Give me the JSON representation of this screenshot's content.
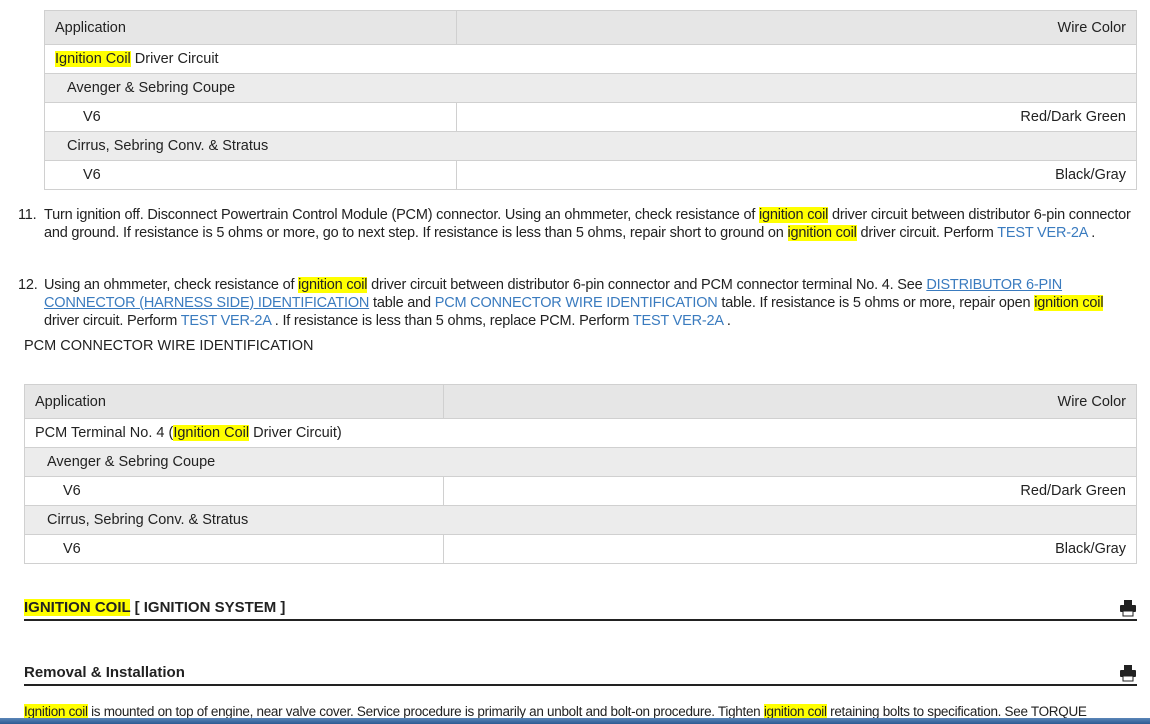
{
  "table1": {
    "headers": [
      "Application",
      "Wire Color"
    ],
    "title": [
      {
        "t": "Ignition Coil",
        "hl": true
      },
      {
        "t": " Driver Circuit"
      }
    ],
    "groups": [
      {
        "name": "Avenger & Sebring Coupe",
        "engine": "V6",
        "color": "Red/Dark Green"
      },
      {
        "name": "Cirrus, Sebring Conv. & Stratus",
        "engine": "V6",
        "color": "Black/Gray"
      }
    ]
  },
  "steps": [
    {
      "num": "11.",
      "segs": [
        {
          "t": "Turn ignition off. Disconnect Powertrain Control Module (PCM) connector. Using an ohmmeter, check resistance of "
        },
        {
          "t": "ignition coil",
          "hl": true
        },
        {
          "t": " driver circuit between distributor 6-pin connector and ground. If resistance is 5 ohms or more, go to next step. If resistance is less than 5 ohms, repair short to ground on "
        },
        {
          "t": "ignition coil",
          "hl": true
        },
        {
          "t": " driver circuit. Perform "
        },
        {
          "t": "TEST VER-2A",
          "link": true
        },
        {
          "t": " ."
        }
      ]
    },
    {
      "num": "12.",
      "segs": [
        {
          "t": "Using an ohmmeter, check resistance of "
        },
        {
          "t": "ignition coil",
          "hl": true
        },
        {
          "t": " driver circuit between distributor 6-pin connector and PCM connector terminal No. 4. See "
        },
        {
          "t": "DISTRIBUTOR 6-PIN CONNECTOR (HARNESS SIDE) IDENTIFICATION",
          "link": true,
          "u": true
        },
        {
          "t": "  table and "
        },
        {
          "t": "PCM CONNECTOR WIRE IDENTIFICATION",
          "link": true
        },
        {
          "t": "  table. If resistance is 5 ohms or more, repair open "
        },
        {
          "t": "ignition coil",
          "hl": true
        },
        {
          "t": " driver circuit. Perform "
        },
        {
          "t": "TEST VER-2A",
          "link": true
        },
        {
          "t": " . If resistance is less than 5 ohms, replace PCM. Perform "
        },
        {
          "t": "TEST VER-2A",
          "link": true
        },
        {
          "t": " ."
        }
      ]
    }
  ],
  "caption": "PCM CONNECTOR WIRE IDENTIFICATION",
  "table2": {
    "headers": [
      "Application",
      "Wire Color"
    ],
    "title": [
      {
        "t": "PCM Terminal No. 4 ("
      },
      {
        "t": "Ignition Coil",
        "hl": true
      },
      {
        "t": " Driver Circuit)"
      }
    ],
    "groups": [
      {
        "name": "Avenger & Sebring Coupe",
        "engine": "V6",
        "color": "Red/Dark Green"
      },
      {
        "name": "Cirrus, Sebring Conv. & Stratus",
        "engine": "V6",
        "color": "Black/Gray"
      }
    ]
  },
  "section1": [
    {
      "t": "IGNITION COIL",
      "hl": true
    },
    {
      "t": " [ IGNITION SYSTEM ]"
    }
  ],
  "section2": [
    {
      "t": "Removal & Installation"
    }
  ],
  "para": [
    {
      "t": "Ignition coil",
      "hl": true
    },
    {
      "t": " is mounted on top of engine, near valve cover. Service procedure is primarily an unbolt and bolt-on procedure. Tighten "
    },
    {
      "t": "ignition coil",
      "hl": true
    },
    {
      "t": " retaining bolts to specification. See TORQUE"
    }
  ],
  "icons": {
    "print": "printer-icon"
  }
}
